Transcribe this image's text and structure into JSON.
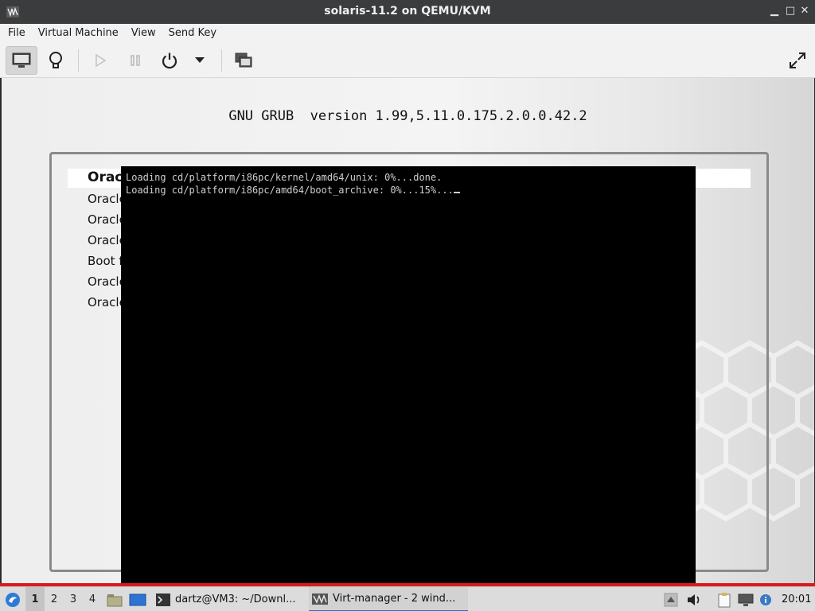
{
  "window": {
    "title": "solaris-11.2 on QEMU/KVM"
  },
  "menu": [
    "File",
    "Virtual Machine",
    "View",
    "Send Key"
  ],
  "grub": {
    "title": "GNU GRUB  version 1.99,5.11.0.175.2.0.0.42.2",
    "entries": [
      "Orac",
      "Oracle",
      "Oracle",
      "Oracle",
      "Boot f",
      "Oracle",
      "Oracle"
    ]
  },
  "console": {
    "lines": [
      "Loading cd/platform/i86pc/kernel/amd64/unix: 0%...done.",
      "Loading cd/platform/i86pc/amd64/boot_archive: 0%...15%..."
    ]
  },
  "taskbar": {
    "workspaces": [
      "1",
      "2",
      "3",
      "4"
    ],
    "tasks": [
      "dartz@VM3: ~/Downl...",
      "Virt-manager - 2 wind..."
    ],
    "clock": "20:01"
  }
}
